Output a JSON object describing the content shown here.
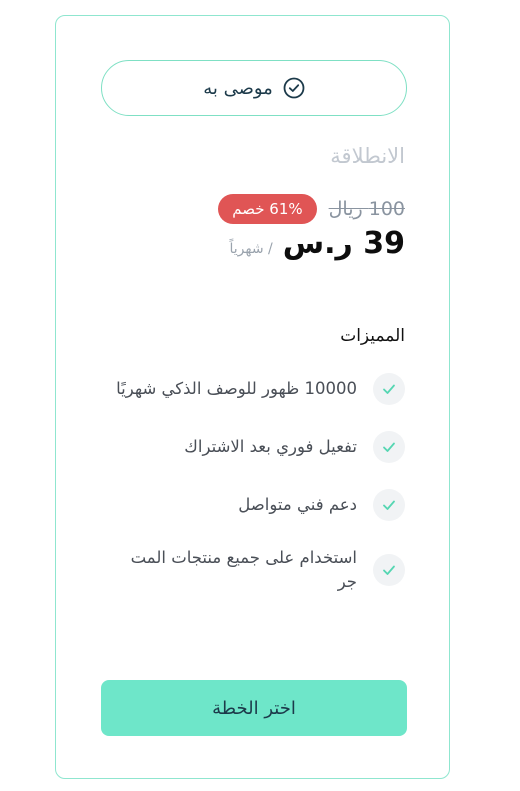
{
  "badge": {
    "label": "موصى به",
    "icon": "check-circle-icon"
  },
  "plan": {
    "name": "الانطلاقة",
    "old_price": "100 ريال",
    "discount": "61% خصم",
    "current_price": "39 ر.س",
    "period": "/ شهرياً"
  },
  "features": {
    "title": "المميزات",
    "items": [
      {
        "text": "10000 ظهور للوصف الذكي شهريًا",
        "icon": "check-icon"
      },
      {
        "text": "تفعيل فوري بعد الاشتراك",
        "icon": "check-icon"
      },
      {
        "text": "دعم فني متواصل",
        "icon": "check-icon"
      },
      {
        "text": "استخدام على جميع منتجات المت جر",
        "icon": "check-icon"
      }
    ]
  },
  "cta": {
    "label": "اختر الخطة"
  },
  "colors": {
    "accent": "#6ee6c9",
    "border": "#8fe6cf",
    "discount": "#e05555",
    "check": "#55d6b2"
  }
}
